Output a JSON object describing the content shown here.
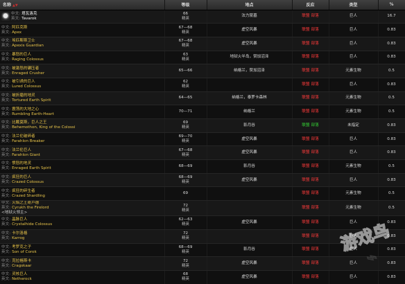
{
  "header": {
    "name": "名称",
    "level": "等级",
    "location": "地点",
    "reaction": "反应",
    "type": "类型",
    "percent": "%"
  },
  "labels": {
    "cn": "中文:",
    "en": "英文:"
  },
  "rows": [
    {
      "cn": "塔瓦洛克",
      "en": "Tavarok",
      "level": "66",
      "level_sub": "精英",
      "location": "法力陵墓",
      "react_a": "联盟",
      "react_h": "部落",
      "react_color": "red",
      "type": "巨人",
      "pct": "16.7",
      "icon": true,
      "white": true,
      "extra": ""
    },
    {
      "cn": "阿匹克斯",
      "en": "Apex",
      "level": "67—68",
      "level_sub": "精英",
      "location": "虚空风暴",
      "react_a": "联盟",
      "react_h": "部落",
      "react_color": "red",
      "type": "巨人",
      "pct": "0.83",
      "icon": false,
      "white": false,
      "extra": ""
    },
    {
      "cn": "埃匹斯斯卫士",
      "en": "Apexis Guardian",
      "level": "67—68",
      "level_sub": "精英",
      "location": "虚空风暴",
      "react_a": "联盟",
      "react_h": "部落",
      "react_color": "red",
      "type": "巨人",
      "pct": "0.83",
      "icon": false,
      "white": false,
      "extra": ""
    },
    {
      "cn": "暴怒的巨人",
      "en": "Raging Colossus",
      "level": "63",
      "level_sub": "精英",
      "location": "地狱火半岛，赞加沼泽",
      "react_a": "联盟",
      "react_h": "部落",
      "react_color": "red",
      "type": "巨人",
      "pct": "0.83",
      "icon": false,
      "white": false,
      "extra": ""
    },
    {
      "cn": "被激怒的碾压者",
      "en": "Enraged Crusher",
      "level": "65—66",
      "level_sub": "",
      "location": "纳格兰，赞加沼泽",
      "react_a": "联盟",
      "react_h": "部落",
      "react_color": "red",
      "type": "元素生物",
      "pct": "0.5",
      "icon": false,
      "white": false,
      "extra": ""
    },
    {
      "cn": "被引诱的巨人",
      "en": "Lured Colossus",
      "level": "62",
      "level_sub": "精英",
      "location": "",
      "react_a": "联盟",
      "react_h": "部落",
      "react_color": "red",
      "type": "巨人",
      "pct": "0.83",
      "icon": false,
      "white": false,
      "extra": ""
    },
    {
      "cn": "被折磨的地灵",
      "en": "Tortured Earth Spirit",
      "level": "64—65",
      "level_sub": "",
      "location": "纳格兰，泰罗卡森林",
      "react_a": "联盟",
      "react_h": "部落",
      "react_color": "red",
      "type": "元素生物",
      "pct": "0.5",
      "icon": false,
      "white": false,
      "extra": ""
    },
    {
      "cn": "震荡的大地之心",
      "en": "Rumbling Earth-Heart",
      "level": "70—71",
      "level_sub": "",
      "location": "纳格兰",
      "react_a": "联盟",
      "react_h": "部落",
      "react_color": "red",
      "type": "元素生物",
      "pct": "0.5",
      "icon": false,
      "white": false,
      "extra": ""
    },
    {
      "cn": "比戴莫斯，巨人之王",
      "en": "Behemothon, King of the Colossi",
      "level": "69",
      "level_sub": "精英",
      "location": "影月谷",
      "react_a": "联盟",
      "react_h": "部落",
      "react_color": "green",
      "type": "未指定",
      "pct": "0.83",
      "icon": false,
      "white": false,
      "extra": ""
    },
    {
      "cn": "法兰伦破碎者",
      "en": "Farahlon Breaker",
      "level": "69—70",
      "level_sub": "精英",
      "location": "虚空风暴",
      "react_a": "联盟",
      "react_h": "部落",
      "react_color": "red",
      "type": "巨人",
      "pct": "0.83",
      "icon": false,
      "white": false,
      "extra": ""
    },
    {
      "cn": "法兰伦巨人",
      "en": "Farahlon Giant",
      "level": "67—68",
      "level_sub": "精英",
      "location": "虚空风暴",
      "react_a": "联盟",
      "react_h": "部落",
      "react_color": "red",
      "type": "巨人",
      "pct": "0.83",
      "icon": false,
      "white": false,
      "extra": ""
    },
    {
      "cn": "愤怒的地灵",
      "en": "Enraged Earth Spirit",
      "level": "68—69",
      "level_sub": "",
      "location": "影月谷",
      "react_a": "联盟",
      "react_h": "部落",
      "react_color": "red",
      "type": "元素生物",
      "pct": "0.5",
      "icon": false,
      "white": false,
      "extra": ""
    },
    {
      "cn": "疯狂的巨人",
      "en": "Crazed Colossus",
      "level": "68—69",
      "level_sub": "精英",
      "location": "虚空风暴",
      "react_a": "联盟",
      "react_h": "部落",
      "react_color": "red",
      "type": "巨人",
      "pct": "0.83",
      "icon": false,
      "white": false,
      "extra": ""
    },
    {
      "cn": "疯狂的碎生者",
      "en": "Crazed Shardling",
      "level": "69",
      "level_sub": "",
      "location": "",
      "react_a": "联盟",
      "react_h": "部落",
      "react_color": "red",
      "type": "元素生物",
      "pct": "0.5",
      "icon": false,
      "white": false,
      "extra": ""
    },
    {
      "cn": "火焰之王奇卢德",
      "en": "Cyrukh the Firelord",
      "level": "72",
      "level_sub": "精英",
      "location": "",
      "react_a": "联盟",
      "react_h": "部落",
      "react_color": "red",
      "type": "元素生物",
      "pct": "0.5",
      "icon": false,
      "white": false,
      "extra": "<地狱火领主>"
    },
    {
      "cn": "晶脉巨人",
      "en": "Crystalhide Colossus",
      "level": "62—63",
      "level_sub": "精英",
      "location": "虚空风暴",
      "react_a": "联盟",
      "react_h": "部落",
      "react_color": "red",
      "type": "巨人",
      "pct": "0.83",
      "icon": false,
      "white": false,
      "extra": ""
    },
    {
      "cn": "卡尔洛格",
      "en": "Karrog",
      "level": "72",
      "level_sub": "精英",
      "location": "",
      "react_a": "联盟",
      "react_h": "部落",
      "react_color": "red",
      "type": "巨人",
      "pct": "0.83",
      "icon": false,
      "white": false,
      "extra": ""
    },
    {
      "cn": "考罗克之子",
      "en": "Son of Corok",
      "level": "68—69",
      "level_sub": "精英",
      "location": "影月谷",
      "react_a": "联盟",
      "react_h": "部落",
      "react_color": "red",
      "type": "巨人",
      "pct": "0.83",
      "icon": false,
      "white": false,
      "extra": ""
    },
    {
      "cn": "克拉格斯卡",
      "en": "Cragskaar",
      "level": "72",
      "level_sub": "精英",
      "location": "虚空风暴",
      "react_a": "联盟",
      "react_h": "部落",
      "react_color": "red",
      "type": "巨人",
      "pct": "0.83",
      "icon": false,
      "white": false,
      "extra": ""
    },
    {
      "cn": "灵核巨人",
      "en": "Netherock",
      "level": "68",
      "level_sub": "精英",
      "location": "虚空风暴",
      "react_a": "联盟",
      "react_h": "部落",
      "react_color": "red",
      "type": "巨人",
      "pct": "0.83",
      "icon": false,
      "white": false,
      "extra": ""
    }
  ],
  "watermark": {
    "text": "游戏鸟",
    "color": "#ffffff"
  },
  "colors": {
    "name_gold": "#e8c44a",
    "react_red": "#ff3b3b",
    "react_green": "#35d335"
  }
}
